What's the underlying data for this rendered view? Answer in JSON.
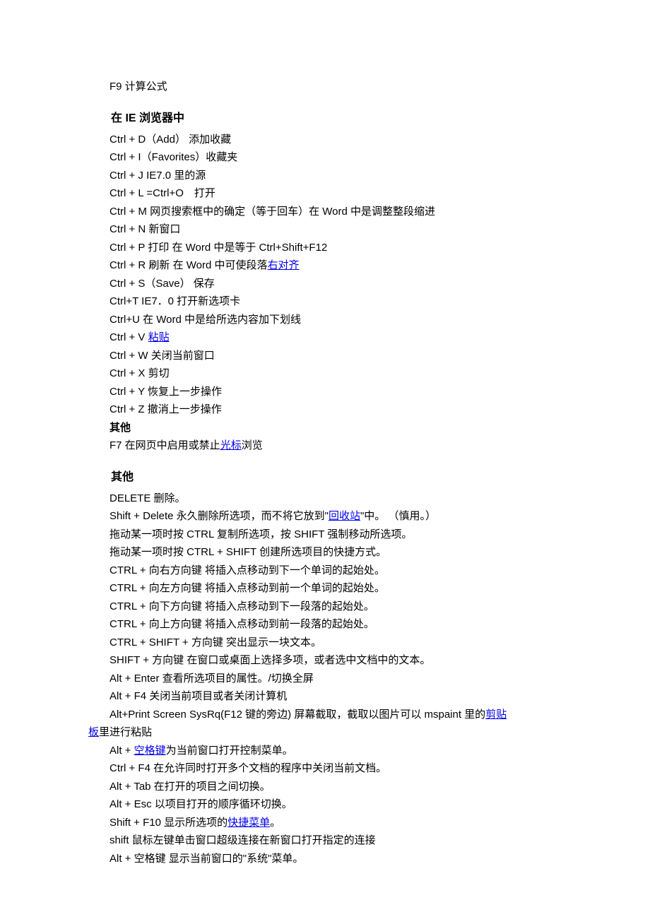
{
  "top_line": "F9 计算公式",
  "heading_ie": "在 IE 浏览器中",
  "ie_lines": [
    "Ctrl + D（Add） 添加收藏",
    "Ctrl + I（Favorites）收藏夹",
    "Ctrl + J IE7.0 里的源",
    "Ctrl + L =Ctrl+O　打开",
    "Ctrl + M 网页搜索框中的确定（等于回车）在 Word 中是调整整段缩进",
    "Ctrl + N 新窗口",
    "Ctrl + P 打印 在 Word 中是等于 Ctrl+Shift+F12"
  ],
  "ie_r_pre": "Ctrl + R 刷新 在 Word 中可使段落",
  "ie_r_link": "右对齐",
  "ie_lines2": [
    "Ctrl + S（Save） 保存",
    "Ctrl+T IE7．0 打开新选项卡",
    "Ctrl+U 在 Word 中是给所选内容加下划线"
  ],
  "ie_v_pre": "Ctrl + V ",
  "ie_v_link": "粘贴",
  "ie_lines3": [
    "Ctrl + W 关闭当前窗口",
    "Ctrl + X 剪切",
    "Ctrl + Y 恢复上一步操作",
    "Ctrl + Z 撤消上一步操作"
  ],
  "ie_other_label": "其他",
  "ie_f7_pre": "F7 在网页中启用或禁止",
  "ie_f7_link": "光标",
  "ie_f7_post": "浏览",
  "heading_other": "其他",
  "other1": "DELETE 删除。",
  "other2_pre": "Shift + Delete 永久删除所选项，而不将它放到\"",
  "other2_link": "回收站",
  "other2_post": "\"中。 （慎用。）",
  "other_lines1": [
    "拖动某一项时按 CTRL 复制所选项，按 SHIFT 强制移动所选项。",
    "拖动某一项时按 CTRL + SHIFT 创建所选项目的快捷方式。",
    "CTRL + 向右方向键 将插入点移动到下一个单词的起始处。",
    "CTRL + 向左方向键 将插入点移动到前一个单词的起始处。",
    "CTRL + 向下方向键 将插入点移动到下一段落的起始处。",
    "CTRL + 向上方向键 将插入点移动到前一段落的起始处。",
    "CTRL + SHIFT + 方向键 突出显示一块文本。",
    "SHIFT + 方向键 在窗口或桌面上选择多项，或者选中文档中的文本。",
    "Alt + Enter 查看所选项目的属性。/切换全屏",
    "Alt + F4 关闭当前项目或者关闭计算机"
  ],
  "other_clip_pre1": "Alt+Print Screen SysRq(F12 键的旁边) 屏幕截取，截取以图片可以 mspaint 里的",
  "other_clip_link1": "剪贴",
  "other_clip_link2": "板",
  "other_clip_post": "里进行粘贴",
  "other_space_pre": "Alt + ",
  "other_space_link": "空格键",
  "other_space_post": "为当前窗口打开控制菜单。",
  "other_lines2": [
    "Ctrl + F4 在允许同时打开多个文档的程序中关闭当前文档。",
    "Alt + Tab 在打开的项目之间切换。",
    "Alt + Esc 以项目打开的顺序循环切换。"
  ],
  "other_f10_pre": "Shift + F10 显示所选项的",
  "other_f10_link": "快捷菜单",
  "other_f10_post": "。",
  "other_lines3": [
    "shift 鼠标左键单击窗口超级连接在新窗口打开指定的连接",
    "Alt + 空格键 显示当前窗口的\"系统\"菜单。"
  ]
}
